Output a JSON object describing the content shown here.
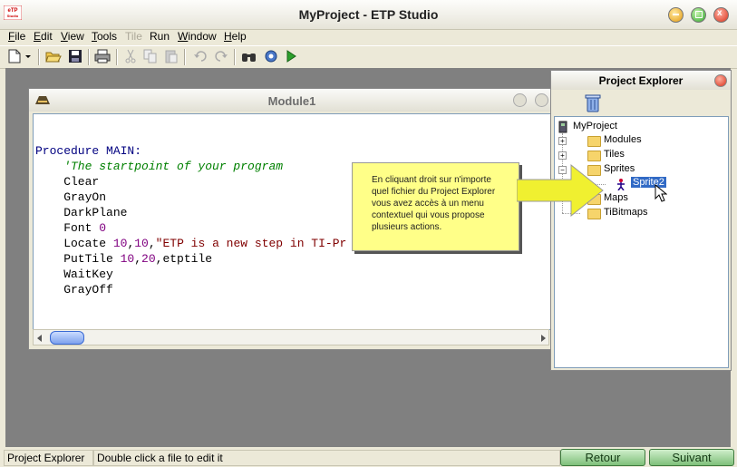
{
  "window": {
    "title": "MyProject - ETP Studio",
    "logo": "ETP Studio"
  },
  "menu": [
    {
      "label": "File",
      "u": "F",
      "rest": "ile",
      "disabled": false
    },
    {
      "label": "Edit",
      "u": "E",
      "rest": "dit",
      "disabled": false
    },
    {
      "label": "View",
      "u": "V",
      "rest": "iew",
      "disabled": false
    },
    {
      "label": "Tools",
      "u": "T",
      "rest": "ools",
      "disabled": false
    },
    {
      "label": "Tile",
      "u": "",
      "rest": "Tile",
      "disabled": true
    },
    {
      "label": "Run",
      "u": "",
      "rest": "Run",
      "disabled": false
    },
    {
      "label": "Window",
      "u": "W",
      "rest": "indow",
      "disabled": false
    },
    {
      "label": "Help",
      "u": "H",
      "rest": "elp",
      "disabled": false
    }
  ],
  "toolbar": {
    "icons": [
      "new-icon",
      "dropdown-icon",
      "open-icon",
      "save-icon",
      "print-icon",
      "cut-icon",
      "copy-icon",
      "paste-icon",
      "undo-icon",
      "redo-icon",
      "find-icon",
      "settings-icon",
      "run-icon"
    ]
  },
  "module": {
    "title": "Module1",
    "code": [
      {
        "t": "Procedure MAIN:",
        "c": "kw"
      },
      {
        "t": "    'The startpoint of your program",
        "c": "cm"
      },
      {
        "t": "    Clear",
        "c": ""
      },
      {
        "t": "    GrayOn",
        "c": ""
      },
      {
        "t": "    DarkPlane",
        "c": ""
      },
      {
        "t": "    Font 0",
        "c": "font"
      },
      {
        "t": "    Locate 10,10,\"ETP is a new step in TI-Pr",
        "c": "locate"
      },
      {
        "t": "    PutTile 10,20,etptile",
        "c": "puttile"
      },
      {
        "t": "    WaitKey",
        "c": ""
      },
      {
        "t": "    GrayOff",
        "c": ""
      }
    ]
  },
  "explorer": {
    "title": "Project Explorer",
    "root": "MyProject",
    "items": [
      "Modules",
      "Tiles",
      "Sprites",
      "Sprite2",
      "Maps",
      "TiBitmaps"
    ],
    "selected": "Sprite2"
  },
  "callout": {
    "text": "En cliquant droit sur n'importe quel fichier du Project Explorer vous avez accès à un menu contextuel qui vous propose plusieurs actions."
  },
  "status": {
    "panel1": "Project Explorer",
    "panel2": "Double click a file to edit it"
  },
  "nav": {
    "back": "Retour",
    "next": "Suivant"
  },
  "colors": {
    "accent_green": "#7fc07a",
    "callout_bg": "#ffff88",
    "arrow": "#f0f030",
    "selection": "#316ac5"
  }
}
